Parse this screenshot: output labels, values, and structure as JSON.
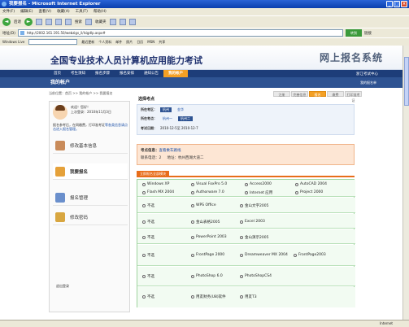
{
  "window": {
    "title": "我要报名 - Microsoft Internet Explorer",
    "min": "_",
    "max": "□",
    "close": "×"
  },
  "menu": [
    "文件(F)",
    "编辑(E)",
    "查看(V)",
    "收藏(A)",
    "工具(T)",
    "帮助(H)"
  ],
  "toolbar": {
    "back": "后退",
    "search": "搜索",
    "favorites": "收藏夹"
  },
  "address": {
    "label": "地址(D)",
    "url": "http://2002.161.191.50/webzigs_il/lsigdlp.aspx#",
    "go": "转到",
    "links": "链接"
  },
  "linksbar": {
    "label": "Windows Live",
    "items": [
      "最近更新",
      "个人资料",
      "邮件",
      "照片",
      "日历",
      "MSN",
      "共享"
    ]
  },
  "site": {
    "title": "全国专业技术人员计算机应用能力考试",
    "brand": "网上报名系统",
    "nav": [
      "首页",
      "考生须知",
      "报名步骤",
      "报名安排",
      "通知公告",
      "我的帐户"
    ],
    "nav_active": 5,
    "nav_right": "浙江考试中心",
    "subheader": "我的帐户",
    "exit": "我的报名单"
  },
  "breadcrumb": "当前位置：首页 >> 我的帐户 >> 我要报名",
  "steps": [
    "注册",
    "完善信息",
    "报名",
    "缴费",
    "打印准考证"
  ],
  "steps_active": 2,
  "sidebar": {
    "greeting": "欢迎！您好！",
    "last_login": "上次登录：2010年11月3日",
    "notice_a": "报名参考后，在网缴费，打印准考证",
    "notice_b": "等各类信息请点击进入报名管理。",
    "items": [
      {
        "label": "修改基本信息",
        "color": "#c98b5a"
      },
      {
        "label": "我要报名",
        "color": "#e5a13a"
      },
      {
        "label": "报名管理",
        "color": "#6a8fcc"
      },
      {
        "label": "修改密码",
        "color": "#d8a640"
      }
    ],
    "active": 1,
    "logout": "退出登录"
  },
  "select": {
    "title": "选择考点",
    "region_label": "所在考区：",
    "regions": [
      "杭州",
      "金华"
    ],
    "site_label": "所在考点：",
    "sites": [
      "杭州一",
      "杭州二"
    ],
    "date_label": "考试日期：",
    "date": "2010-12-5至 2010-12-7"
  },
  "info": {
    "label": "考点信息：",
    "link": "查看乘车路线",
    "seats": "联系电话：2",
    "addr": "地址：杭州西湖大道二"
  },
  "tab": "立即报名全部模块",
  "subjects": [
    [
      "Windows XP",
      "Visual FoxPro 5.0",
      "Access2000",
      "AutoCAD 2004"
    ],
    [
      "Flash MX 2004",
      "Authorware 7.0",
      "Internet 应用",
      "Project 2000"
    ],
    [
      "不选",
      "WPS Office",
      "金山文字2005",
      ""
    ],
    [
      "不选",
      "金山表格2005",
      "Excel 2003",
      ""
    ],
    [
      "不选",
      "PowerPoint 2003",
      "金山演示2005",
      ""
    ],
    [
      "不选",
      "FrontPage 2000",
      "Dreamweaver MX 2004",
      "FrontPage2003"
    ],
    [
      "不选",
      "PhotoShop 6.0",
      "PhotoShopCS4",
      ""
    ],
    [
      "不选",
      "用友财务(U8)软件",
      "用友T3",
      ""
    ]
  ],
  "status": {
    "left": "",
    "zone": "Internet"
  }
}
